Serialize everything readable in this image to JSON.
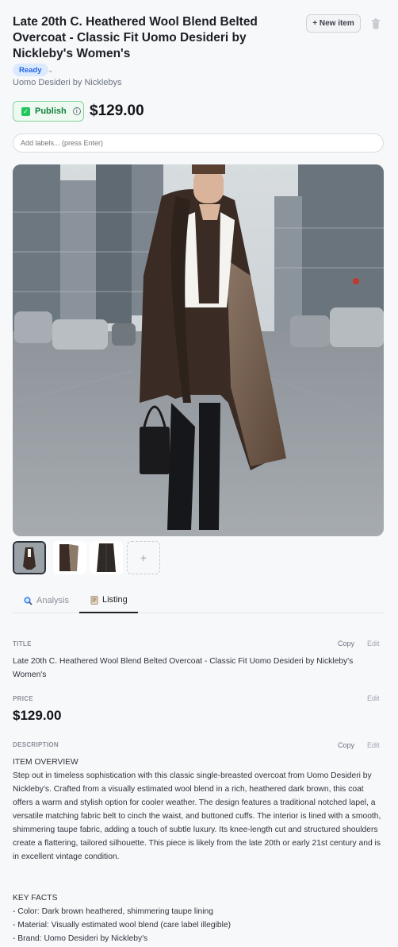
{
  "header": {
    "title": "Late 20th C. Heathered Wool Blend Belted Overcoat - Classic Fit Uomo Desideri by Nickleby's Women's",
    "new_item_label": "+ New item",
    "status": "Ready",
    "brand": "Uomo Desideri by Nicklebys",
    "publish_label": "Publish",
    "price": "$129.00"
  },
  "labels_input": {
    "placeholder": "Add labels... (press Enter)"
  },
  "tabs": [
    {
      "label": "Analysis",
      "icon": "magnifier-icon"
    },
    {
      "label": "Listing",
      "icon": "document-icon"
    }
  ],
  "sections": {
    "title": {
      "label": "TITLE",
      "copy": "Copy",
      "edit": "Edit",
      "value": "Late 20th C. Heathered Wool Blend Belted Overcoat - Classic Fit Uomo Desideri by Nickleby's Women's"
    },
    "price": {
      "label": "PRICE",
      "edit": "Edit",
      "value": "$129.00"
    },
    "description": {
      "label": "DESCRIPTION",
      "copy": "Copy",
      "edit": "Edit",
      "overview_heading": "ITEM OVERVIEW",
      "overview": "Step out in timeless sophistication with this classic single-breasted overcoat from Uomo Desideri by Nickleby's. Crafted from a visually estimated wool blend in a rich, heathered dark brown, this coat offers a warm and stylish option for cooler weather. The design features a traditional notched lapel, a versatile matching fabric belt to cinch the waist, and buttoned cuffs. The interior is lined with a smooth, shimmering taupe fabric, adding a touch of subtle luxury. Its knee-length cut and structured shoulders create a flattering, tailored silhouette. This piece is likely from the late 20th or early 21st century and is in excellent vintage condition.",
      "facts_heading": "KEY FACTS",
      "facts": [
        "- Color: Dark brown heathered, shimmering taupe lining",
        "- Material: Visually estimated wool blend (care label illegible)",
        "- Brand: Uomo Desideri by Nickleby's"
      ]
    }
  },
  "colors": {
    "accent_green": "#22c55e",
    "status_blue": "#2563eb",
    "coat_brown": "#3a2c24"
  }
}
